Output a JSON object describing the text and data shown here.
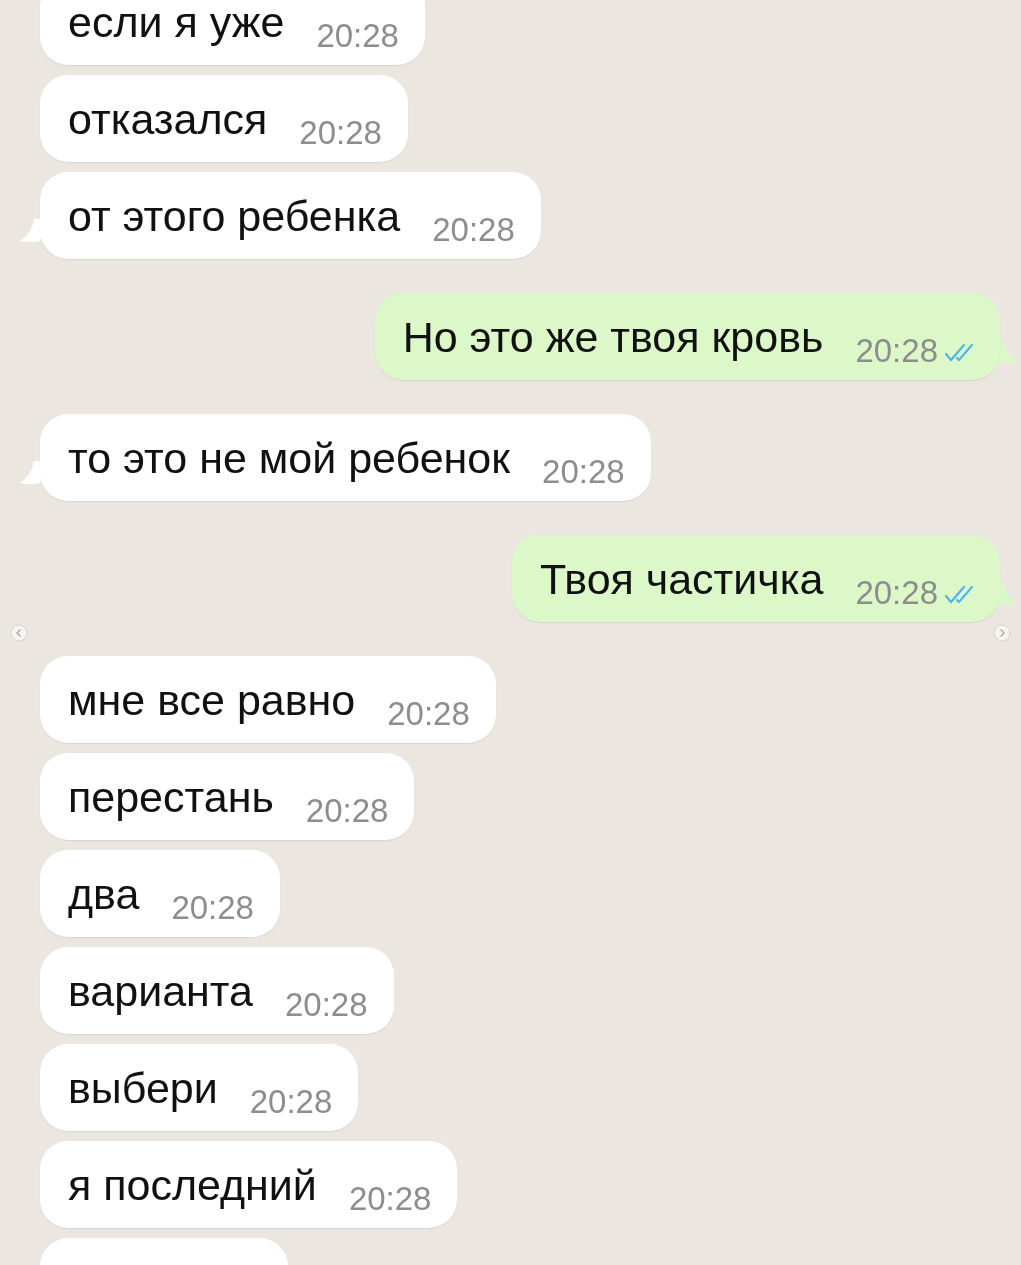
{
  "messages": [
    {
      "kind": "incoming",
      "text": "если я уже",
      "time": "20:28",
      "tail": false
    },
    {
      "kind": "incoming",
      "text": "отказался",
      "time": "20:28",
      "tail": false
    },
    {
      "kind": "incoming",
      "text": "от этого ребенка",
      "time": "20:28",
      "tail": true
    },
    {
      "kind": "outgoing",
      "text": "Но это же твоя кровь",
      "time": "20:28",
      "tail": true,
      "read": true
    },
    {
      "kind": "incoming",
      "text": "то это не мой ребенок",
      "time": "20:28",
      "tail": true
    },
    {
      "kind": "outgoing",
      "text": "Твоя частичка",
      "time": "20:28",
      "tail": true,
      "read": true
    },
    {
      "kind": "incoming",
      "text": "мне все равно",
      "time": "20:28",
      "tail": false
    },
    {
      "kind": "incoming",
      "text": "перестань",
      "time": "20:28",
      "tail": false
    },
    {
      "kind": "incoming",
      "text": "два",
      "time": "20:28",
      "tail": false
    },
    {
      "kind": "incoming",
      "text": "варианта",
      "time": "20:28",
      "tail": false
    },
    {
      "kind": "incoming",
      "text": "выбери",
      "time": "20:28",
      "tail": false
    },
    {
      "kind": "incoming",
      "text": "я последний",
      "time": "20:28",
      "tail": false
    },
    {
      "kind": "stub",
      "tail": false
    }
  ]
}
